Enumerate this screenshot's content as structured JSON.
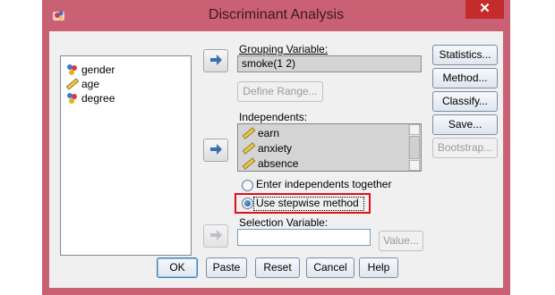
{
  "window": {
    "title": "Discriminant Analysis",
    "close_glyph": "✕"
  },
  "variables": [
    {
      "name": "gender",
      "icon": "nominal-icon"
    },
    {
      "name": "age",
      "icon": "scale-icon"
    },
    {
      "name": "degree",
      "icon": "nominal-icon"
    }
  ],
  "grouping": {
    "label": "Grouping Variable:",
    "value": "smoke(1 2)",
    "define_range": "Define Range..."
  },
  "independents": {
    "label": "Independents:",
    "items": [
      {
        "name": "earn",
        "icon": "scale-icon"
      },
      {
        "name": "anxiety",
        "icon": "scale-icon"
      },
      {
        "name": "absence",
        "icon": "scale-icon"
      }
    ]
  },
  "method_options": {
    "enter": "Enter independents together",
    "stepwise": "Use stepwise method",
    "selected": "stepwise"
  },
  "selection": {
    "label": "Selection Variable:",
    "value": "",
    "value_button": "Value..."
  },
  "side_buttons": [
    "Statistics...",
    "Method...",
    "Classify...",
    "Save...",
    "Bootstrap..."
  ],
  "bottom_buttons": [
    "OK",
    "Paste",
    "Reset",
    "Cancel",
    "Help"
  ],
  "colors": {
    "frame": "#c96073",
    "highlight": "#e00f17",
    "close": "#c42b2b"
  }
}
